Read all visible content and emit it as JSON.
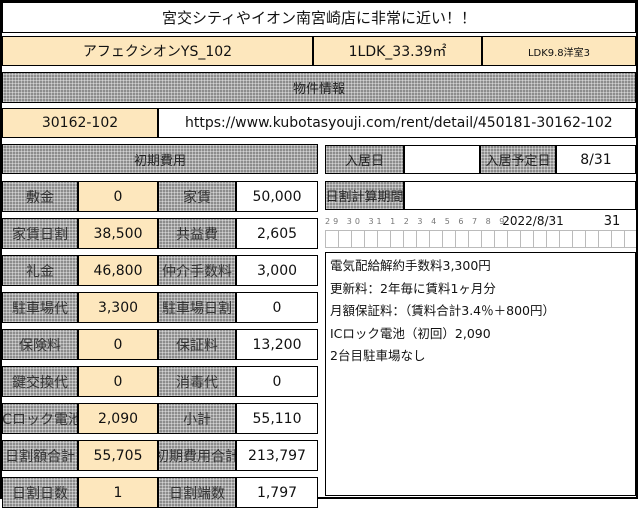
{
  "title": "宮交シティやイオン南宮崎店に非常に近い！！",
  "property": {
    "name": "アフェクシオンYS_102",
    "layout_area": "1LDK_33.39㎡",
    "room_detail": "LDK9.8洋室3"
  },
  "section_header": "物件情報",
  "id_row": {
    "code": "30162-102",
    "url": "https://www.kubotasyouji.com/rent/detail/450181-30162-102"
  },
  "fees": {
    "header": "初期費用",
    "rows": [
      {
        "l1": "敷金",
        "v1": "0",
        "l2": "家賃",
        "v2": "50,000"
      },
      {
        "l1": "家賃日割",
        "v1": "38,500",
        "l2": "共益費",
        "v2": "2,605"
      },
      {
        "l1": "礼金",
        "v1": "46,800",
        "l2": "仲介手数料",
        "v2": "3,000"
      },
      {
        "l1": "駐車場代",
        "v1": "3,300",
        "l2": "駐車場日割",
        "v2": "0"
      },
      {
        "l1": "保険料",
        "v1": "0",
        "l2": "保証料",
        "v2": "13,200"
      },
      {
        "l1": "鍵交換代",
        "v1": "0",
        "l2": "消毒代",
        "v2": "0"
      },
      {
        "l1": "ICロック電池",
        "v1": "2,090",
        "l2": "小計",
        "v2": "55,110"
      },
      {
        "l1": "日割額合計",
        "v1": "55,705",
        "l2": "初期費用合計",
        "v2": "213,797"
      },
      {
        "l1": "日割日数",
        "v1": "1",
        "l2": "日割端数",
        "v2": "1,797"
      }
    ]
  },
  "right": {
    "move_in_label": "入居日",
    "move_in_value": "",
    "contract_label": "入居予定日",
    "contract_value": "8/31",
    "calc_label": "日割計算期間",
    "calc_value": "",
    "calendar_strip": "29 30 31 1 2 3 4 5 6 7 8 9 10 11",
    "calc_date": "2022/8/31",
    "calc_days": "31",
    "notes": [
      "電気配給解約手数料3,300円",
      "更新料：2年毎に賃料1ヶ月分",
      "月額保証料：（賃料合計3.4％＋800円）",
      "ICロック電池（初回）2,090",
      "2台目駐車場なし"
    ]
  }
}
